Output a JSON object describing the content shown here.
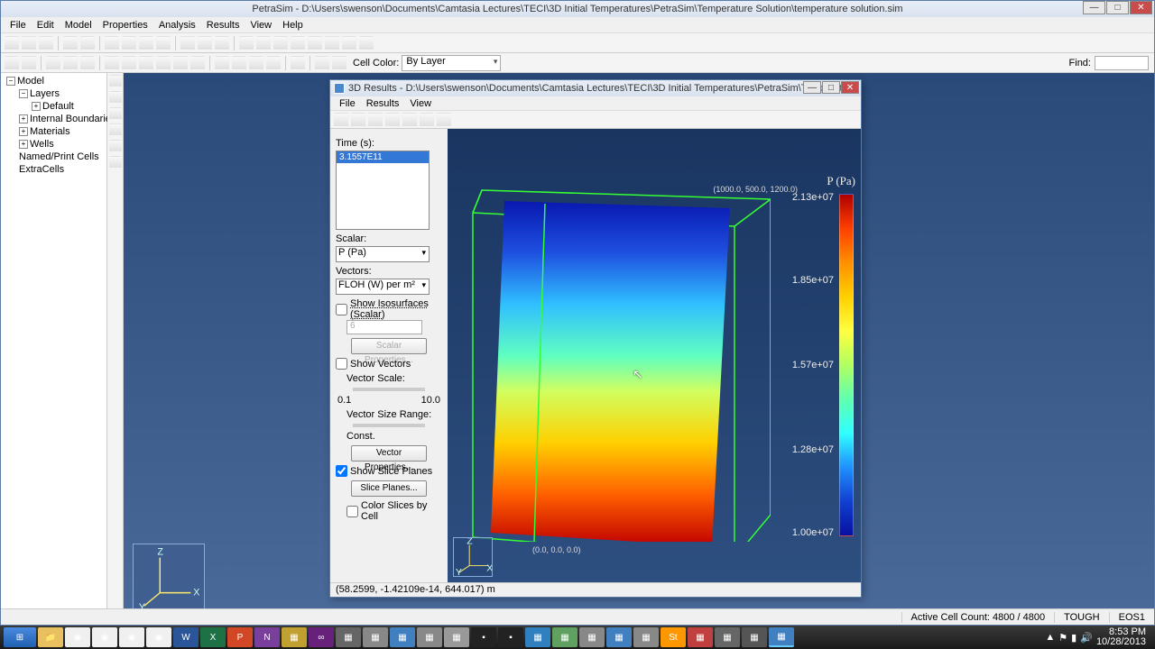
{
  "app": {
    "title": "PetraSim - D:\\Users\\swenson\\Documents\\Camtasia Lectures\\TECI\\3D Initial Temperatures\\PetraSim\\Temperature Solution\\temperature solution.sim",
    "min": "—",
    "max": "□",
    "close": "✕"
  },
  "menu": [
    "File",
    "Edit",
    "Model",
    "Properties",
    "Analysis",
    "Results",
    "View",
    "Help"
  ],
  "toolbar2": {
    "cellcolor_label": "Cell Color:",
    "cellcolor_value": "By Layer",
    "find_label": "Find:"
  },
  "tree": {
    "root": "Model",
    "items": [
      {
        "label": "Layers",
        "sub": 1,
        "exp": "−"
      },
      {
        "label": "Default",
        "sub": 2,
        "exp": "+"
      },
      {
        "label": "Internal Boundaries",
        "sub": 1,
        "exp": "+"
      },
      {
        "label": "Materials",
        "sub": 1,
        "exp": "+"
      },
      {
        "label": "Wells",
        "sub": 1,
        "exp": "+"
      },
      {
        "label": "Named/Print Cells",
        "sub": 1,
        "exp": ""
      },
      {
        "label": "ExtraCells",
        "sub": 1,
        "exp": ""
      }
    ]
  },
  "sub": {
    "title": "3D Results - D:\\Users\\swenson\\Documents\\Camtasia Lectures\\TECI\\3D Initial Temperatures\\PetraSim\\Temperatu...",
    "menu": [
      "File",
      "Results",
      "View"
    ],
    "panel": {
      "time_label": "Time (s):",
      "time_selected": "3.1557E11",
      "scalar_label": "Scalar:",
      "scalar_value": "P (Pa)",
      "vectors_label": "Vectors:",
      "vectors_value": "FLOH (W) per m²",
      "show_iso": "Show Isosurfaces (Scalar)",
      "iso_count": "6",
      "scalar_props": "Scalar Properties...",
      "show_vectors": "Show Vectors",
      "vector_scale": "Vector Scale:",
      "vs_min": "0.1",
      "vs_max": "10.0",
      "vector_size_range": "Vector Size Range:",
      "const": "Const.",
      "vector_props": "Vector Properties...",
      "show_slice": "Show Slice Planes",
      "slice_planes": "Slice Planes...",
      "color_slices": "Color Slices by Cell"
    },
    "viz": {
      "title": "P (Pa)",
      "ticks": [
        "2.13e+07",
        "1.85e+07",
        "1.57e+07",
        "1.28e+07",
        "1.00e+07"
      ],
      "coord_top": "(1000.0, 500.0, 1200.0)",
      "coord_bot": "(0.0, 0.0, 0.0)"
    },
    "status": "(58.2599, -1.42109e-14, 644.017) m"
  },
  "status": {
    "cellcount": "Active Cell Count: 4800 / 4800",
    "sim": "TOUGH",
    "eos": "EOS1"
  },
  "tray": {
    "time": "8:53 PM",
    "date": "10/28/2013"
  },
  "chart_data": {
    "type": "heatmap",
    "title": "P (Pa)",
    "colorbar_range": [
      10000000.0,
      21300000.0
    ],
    "colorbar_ticks": [
      21300000.0,
      18500000.0,
      15700000.0,
      12800000.0,
      10000000.0
    ],
    "domain_corner_min": [
      0.0,
      0.0,
      0.0
    ],
    "domain_corner_max": [
      1000.0,
      500.0,
      1200.0
    ],
    "description": "Vertical slice plane colored by pressure P (Pa); pressure increases roughly linearly with depth from ~1.0e7 at top to ~2.13e7 at bottom."
  }
}
